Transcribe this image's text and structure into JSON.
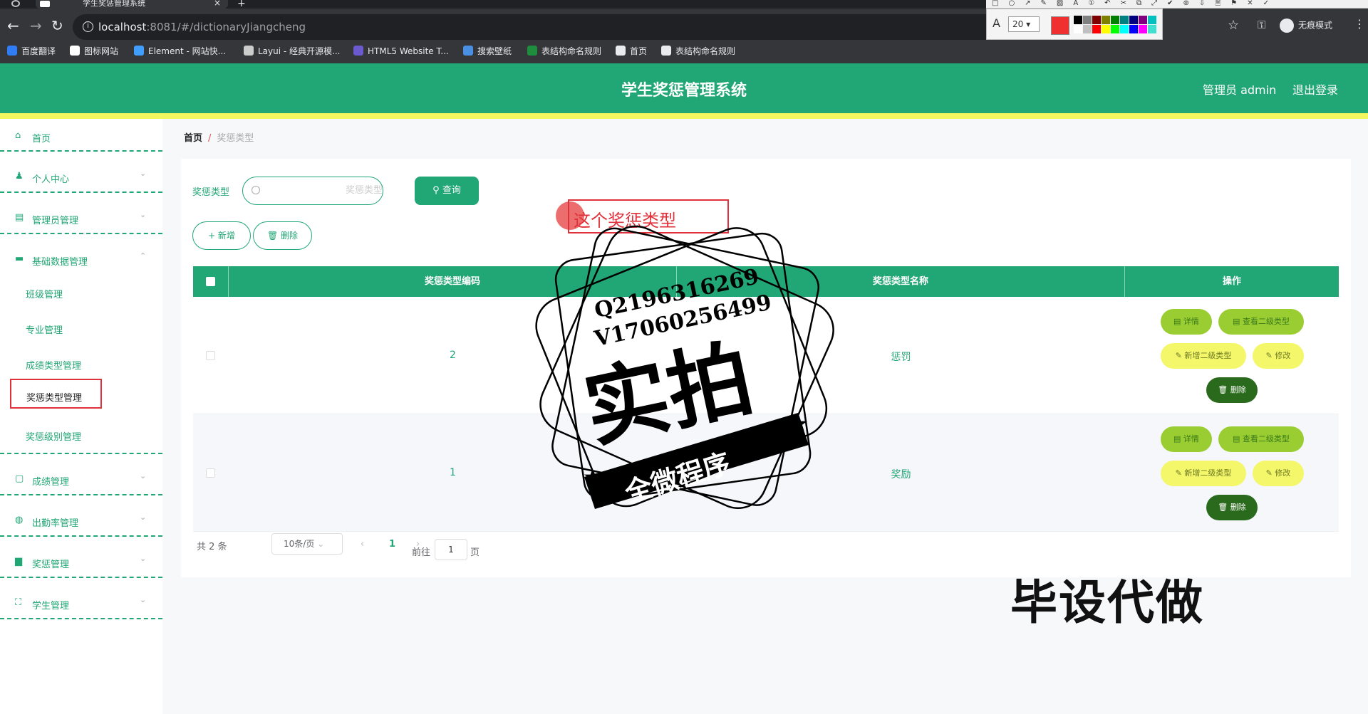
{
  "browser": {
    "tab_title": "学生奖惩管理系统",
    "tab_close": "×",
    "new_tab": "+",
    "back": "←",
    "forward": "→",
    "reload": "↻",
    "url_host": "localhost",
    "url_path": ":8081/#/dictionaryJiangcheng",
    "star": "☆",
    "key": "⚿",
    "incognito_label": "无痕模式",
    "menu": "⋮",
    "bookmarks": [
      {
        "label": "百度翻译",
        "color": "#2f7cf6"
      },
      {
        "label": "图标网站",
        "color": "#ffffff"
      },
      {
        "label": "Element - 网站快...",
        "color": "#409eff"
      },
      {
        "label": "Layui - 经典开源模...",
        "color": "#cccccc"
      },
      {
        "label": "HTML5 Website T...",
        "color": "#6a5acd"
      },
      {
        "label": "搜索壁纸",
        "color": "#4a90e2"
      },
      {
        "label": "表结构命名规则",
        "color": "#1e8e3e"
      },
      {
        "label": "首页",
        "color": "#e8eaed"
      },
      {
        "label": "表结构命名规则",
        "color": "#e8eaed"
      }
    ]
  },
  "draw_toolbar": {
    "icons": "□○↗✎▨A①↶✂⧉⤢✔⊚⇩🗎⚑✕✓",
    "font_icon": "A",
    "size": "20",
    "size_arrow": "▾",
    "current_color": "#f03030",
    "swatches": [
      "#000000",
      "#808080",
      "#800000",
      "#808000",
      "#008000",
      "#008080",
      "#000080",
      "#800080",
      "#00c0c0",
      "#ffffff",
      "#c0c0c0",
      "#ff0000",
      "#ffff00",
      "#00ff00",
      "#00ffff",
      "#0000ff",
      "#ff00ff",
      "#40e0d0"
    ]
  },
  "header": {
    "title": "学生奖惩管理系统",
    "admin": "管理员 admin",
    "logout": "退出登录"
  },
  "sidebar": {
    "items": [
      {
        "label": "首页",
        "icon": "⌂",
        "has_chevron": false
      },
      {
        "label": "个人中心",
        "icon": "♟",
        "has_chevron": true
      },
      {
        "label": "管理员管理",
        "icon": "▤",
        "has_chevron": true
      },
      {
        "label": "基础数据管理",
        "icon": "▬",
        "has_chevron": true,
        "expanded": true
      },
      {
        "label": "成绩管理",
        "icon": "▢",
        "has_chevron": true
      },
      {
        "label": "出勤率管理",
        "icon": "◍",
        "has_chevron": true
      },
      {
        "label": "奖惩管理",
        "icon": "▆",
        "has_chevron": true
      },
      {
        "label": "学生管理",
        "icon": "⛶",
        "has_chevron": true
      }
    ],
    "chevron_down": "⌄",
    "chevron_up": "⌃",
    "sub_items": [
      "班级管理",
      "专业管理",
      "成绩类型管理",
      "奖惩类型管理",
      "奖惩级别管理"
    ],
    "active_sub": "奖惩类型管理"
  },
  "breadcrumb": {
    "home": "首页",
    "separator": "/",
    "current": "奖惩类型"
  },
  "search": {
    "label": "奖惩类型",
    "placeholder": "奖惩类型",
    "button": "查询",
    "button_icon": "⚲"
  },
  "actions": {
    "add": "+ 新增",
    "delete": "🗑 删除"
  },
  "table": {
    "columns": [
      "奖惩类型编码",
      "奖惩类型名称",
      "操作"
    ],
    "rows": [
      {
        "code": "2",
        "name": "惩罚"
      },
      {
        "code": "1",
        "name": "奖励"
      }
    ],
    "row_actions": {
      "detail": "▤ 详情",
      "view_second": "▤ 查看二级类型",
      "add_second": "✎ 新增二级类型",
      "edit": "✎ 修改",
      "delete": "🗑 删除"
    }
  },
  "pagination": {
    "total": "共 2 条",
    "page_size": "10条/页",
    "page_size_arrow": "⌄",
    "prev": "‹",
    "current": "1",
    "next": "›",
    "goto_prefix": "前往",
    "goto_value": "1",
    "goto_suffix": "页"
  },
  "overlays": {
    "annotation": "这个奖惩类型",
    "stamp_line1": "Q2196316269",
    "stamp_line2": "V17060256499",
    "stamp_main": "实拍",
    "stamp_banner": "全微程序",
    "watermark": "毕设代做"
  }
}
